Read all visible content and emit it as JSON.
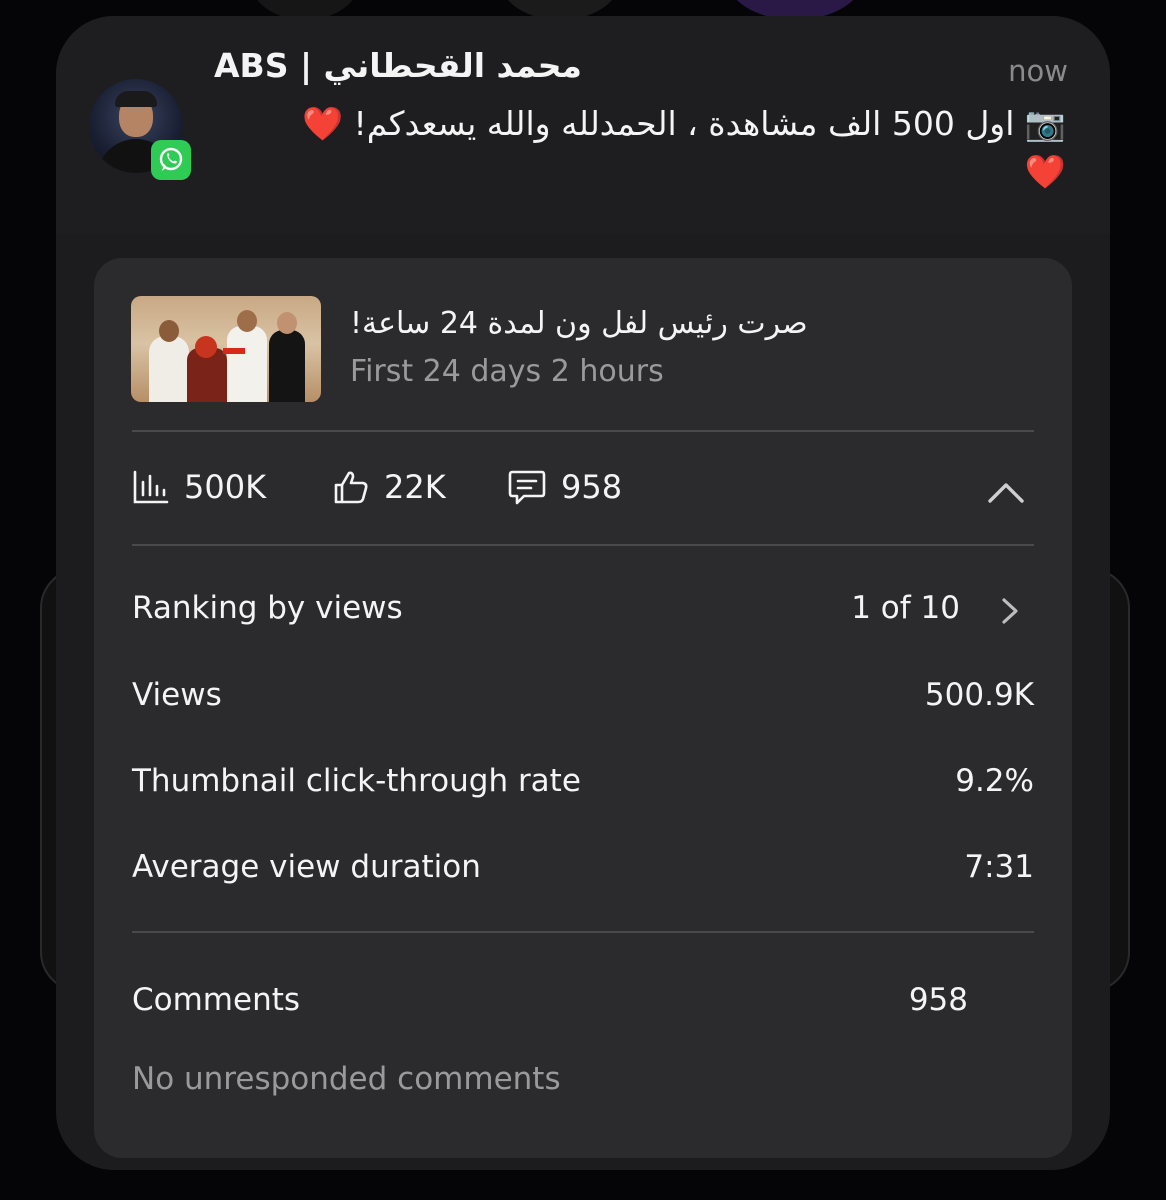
{
  "notification": {
    "sender": "ABS | محمد القحطاني",
    "time": "now",
    "message_line1": "📷 اول 500 الف مشاهدة ، الحمدلله والله يسعدكم! ❤️",
    "message_line2": "❤️"
  },
  "video": {
    "title": "صرت رئيس لفل ون لمدة 24 ساعة!",
    "subtitle": "First 24 days 2 hours"
  },
  "stats": {
    "views": "500K",
    "likes": "22K",
    "comments": "958"
  },
  "metrics": [
    {
      "label": "Ranking by views",
      "value": "1 of 10"
    },
    {
      "label": "Views",
      "value": "500.9K"
    },
    {
      "label": "Thumbnail click-through rate",
      "value": "9.2%"
    },
    {
      "label": "Average view duration",
      "value": "7:31"
    }
  ],
  "comments_section": {
    "label": "Comments",
    "value": "958",
    "note": "No unresponded comments"
  },
  "colors": {
    "whatsapp": "#2ecc55",
    "panel": "#2b2b2d",
    "notification": "#1c1c1e"
  },
  "icons": [
    "whatsapp-icon",
    "bar-chart-icon",
    "thumbs-up-icon",
    "comment-icon",
    "chevron-up-icon",
    "chevron-right-icon"
  ]
}
